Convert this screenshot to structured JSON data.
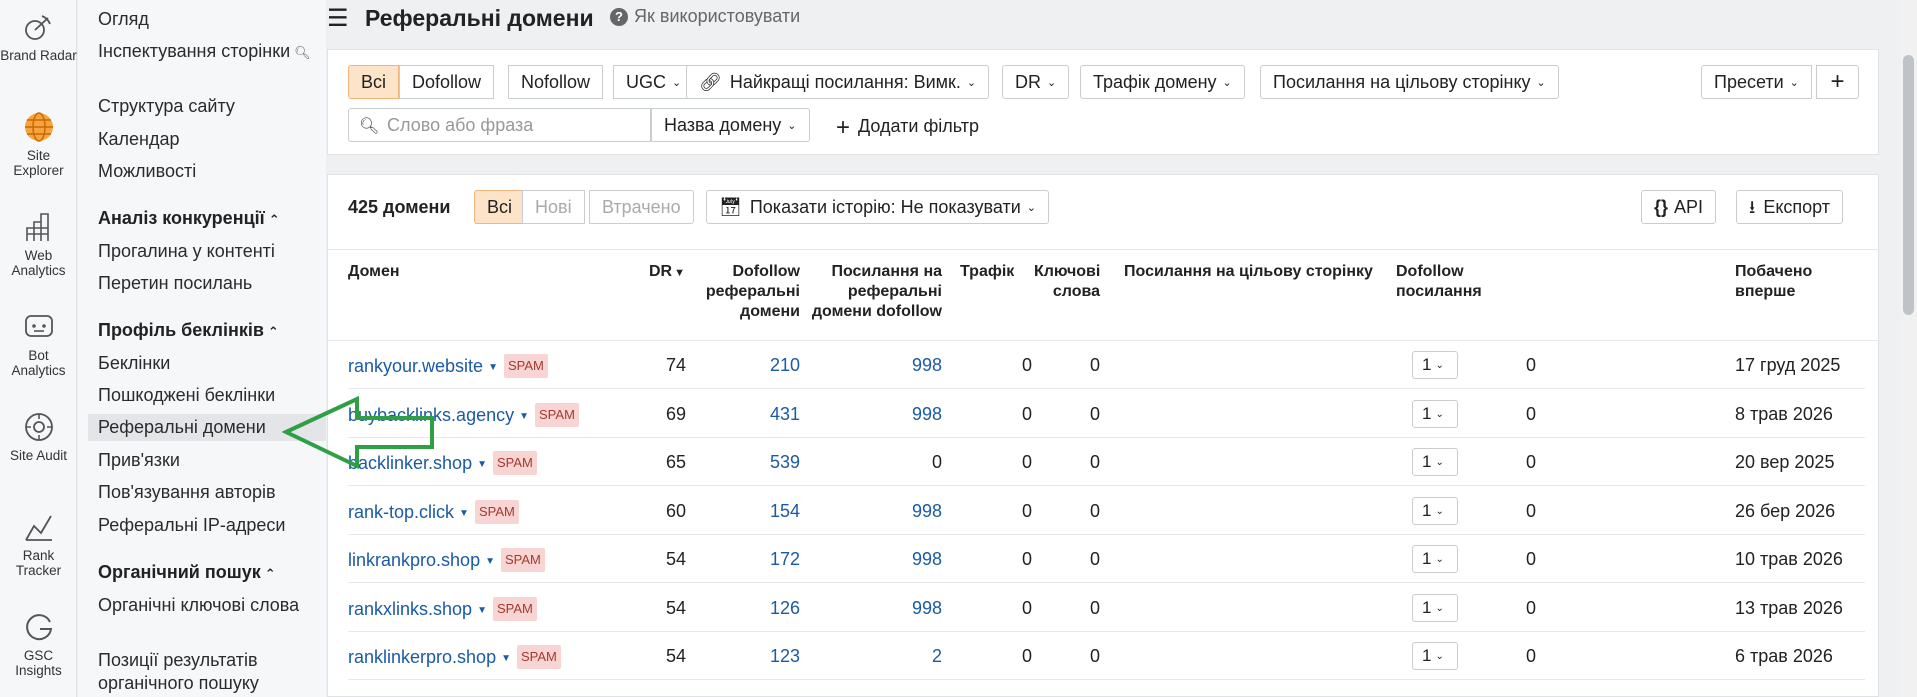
{
  "rail": [
    {
      "label": "Brand Radar",
      "icon": "brand-radar-icon"
    },
    {
      "label": "Site Explorer",
      "icon": "site-explorer-icon"
    },
    {
      "label": "Web Analytics",
      "icon": "web-analytics-icon"
    },
    {
      "label": "Bot Analytics",
      "icon": "bot-analytics-icon"
    },
    {
      "label": "Site Audit",
      "icon": "site-audit-icon"
    },
    {
      "label": "Rank Tracker",
      "icon": "rank-tracker-icon"
    },
    {
      "label": "GSC Insights",
      "icon": "gsc-insights-icon"
    }
  ],
  "nav": {
    "overview": "Огляд",
    "inspect": "Інспектування сторінки",
    "structure": "Структура сайту",
    "calendar": "Календар",
    "opportunities": "Можливості",
    "competitive_head": "Аналіз конкуренції",
    "content_gap": "Прогалина у контенті",
    "link_intersect": "Перетин посилань",
    "backlink_head": "Профіль беклінків",
    "backlinks": "Беклінки",
    "broken": "Пошкоджені беклінки",
    "ref_domains": "Реферальні домени",
    "anchors": "Прив'язки",
    "authors": "Пов'язування авторів",
    "ref_ips": "Реферальні IP-адреси",
    "organic_head": "Органічний пошук",
    "organic_kw": "Органічні ключові слова",
    "organic_pos": "Позиції результатів органічного пошуку"
  },
  "header": {
    "title": "Реферальні домени",
    "help": "Як використовувати"
  },
  "filters": {
    "all": "Всі",
    "dofollow": "Dofollow",
    "nofollow": "Nofollow",
    "ugc": "UGC",
    "best_links": "Найкращі посилання: Вимк.",
    "dr": "DR",
    "traffic": "Трафік домену",
    "target_links": "Посилання на цільову сторінку",
    "presets": "Пресети",
    "search_placeholder": "Слово або фраза",
    "domain_name": "Назва домену",
    "add_filter": "Додати фільтр"
  },
  "results": {
    "count": "425 домени",
    "tab_all": "Всі",
    "tab_new": "Нові",
    "tab_lost": "Втрачено",
    "history": "Показати історію: Не показувати",
    "api": "API",
    "export": "Експорт"
  },
  "columns": {
    "domain": "Домен",
    "dr": "DR",
    "dofollow_ref": "Dofollow реферальні домени",
    "links_to_ref": "Посилання на реферальні домени dofollow",
    "traffic": "Трафік",
    "keywords": "Ключові слова",
    "target_links": "Посилання на цільову сторінку",
    "dofollow_links": "Dofollow посилання",
    "first_seen": "Побачено вперше"
  },
  "rows": [
    {
      "domain": "rankyour.website",
      "spam": "SPAM",
      "dr": "74",
      "dofollow_ref": "210",
      "links": "998",
      "traffic": "0",
      "keywords": "0",
      "target": "1",
      "dofollow_links": "0",
      "first_seen": "17 груд 2025"
    },
    {
      "domain": "buybacklinks.agency",
      "spam": "SPAM",
      "dr": "69",
      "dofollow_ref": "431",
      "links": "998",
      "traffic": "0",
      "keywords": "0",
      "target": "1",
      "dofollow_links": "0",
      "first_seen": "8 трав 2026"
    },
    {
      "domain": "backlinker.shop",
      "spam": "SPAM",
      "dr": "65",
      "dofollow_ref": "539",
      "links": "0",
      "traffic": "0",
      "keywords": "0",
      "target": "1",
      "dofollow_links": "0",
      "first_seen": "20 вер 2025"
    },
    {
      "domain": "rank-top.click",
      "spam": "SPAM",
      "dr": "60",
      "dofollow_ref": "154",
      "links": "998",
      "traffic": "0",
      "keywords": "0",
      "target": "1",
      "dofollow_links": "0",
      "first_seen": "26 бер 2026"
    },
    {
      "domain": "linkrankpro.shop",
      "spam": "SPAM",
      "dr": "54",
      "dofollow_ref": "172",
      "links": "998",
      "traffic": "0",
      "keywords": "0",
      "target": "1",
      "dofollow_links": "0",
      "first_seen": "10 трав 2026"
    },
    {
      "domain": "rankxlinks.shop",
      "spam": "SPAM",
      "dr": "54",
      "dofollow_ref": "126",
      "links": "998",
      "traffic": "0",
      "keywords": "0",
      "target": "1",
      "dofollow_links": "0",
      "first_seen": "13 трав 2026"
    },
    {
      "domain": "ranklinkerpro.shop",
      "spam": "SPAM",
      "dr": "54",
      "dofollow_ref": "123",
      "links": "2",
      "traffic": "0",
      "keywords": "0",
      "target": "1",
      "dofollow_links": "0",
      "first_seen": "6 трав 2026"
    }
  ],
  "colors": {
    "accent_selected": "#fde3c7",
    "link": "#1a5aa6",
    "spam_bg": "#f8d5d2",
    "annotation_arrow": "#2ea043"
  }
}
